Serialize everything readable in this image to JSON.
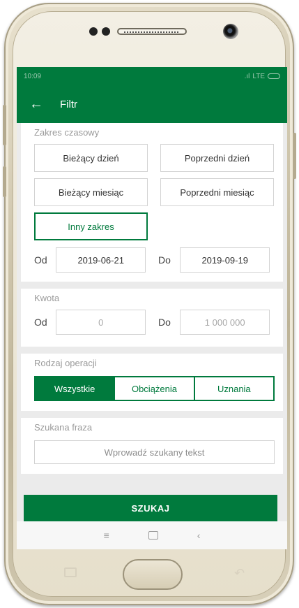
{
  "status": {
    "time": "10:09",
    "network": "LTE"
  },
  "appbar": {
    "title": "Filtr"
  },
  "time_range": {
    "title": "Zakres czasowy",
    "options": [
      "Bieżący dzień",
      "Poprzedni dzień",
      "Bieżący miesiąc",
      "Poprzedni miesiąc",
      "Inny zakres"
    ],
    "active_option": "Inny zakres",
    "from_label": "Od",
    "from_value": "2019-06-21",
    "to_label": "Do",
    "to_value": "2019-09-19"
  },
  "amount": {
    "title": "Kwota",
    "from_label": "Od",
    "from_placeholder": "0",
    "to_label": "Do",
    "to_placeholder": "1 000 000"
  },
  "operation_type": {
    "title": "Rodzaj operacji",
    "options": [
      "Wszystkie",
      "Obciążenia",
      "Uznania"
    ],
    "active_option": "Wszystkie"
  },
  "search": {
    "title": "Szukana fraza",
    "placeholder": "Wprowadź szukany tekst"
  },
  "submit_label": "SZUKAJ",
  "colors": {
    "primary": "#007a3d",
    "background": "#ebebeb",
    "border": "#d3d3d3"
  },
  "icons": [
    "back-arrow-icon",
    "battery-icon",
    "signal-icon",
    "nav-recent-icon",
    "nav-home-icon",
    "nav-back-icon"
  ]
}
